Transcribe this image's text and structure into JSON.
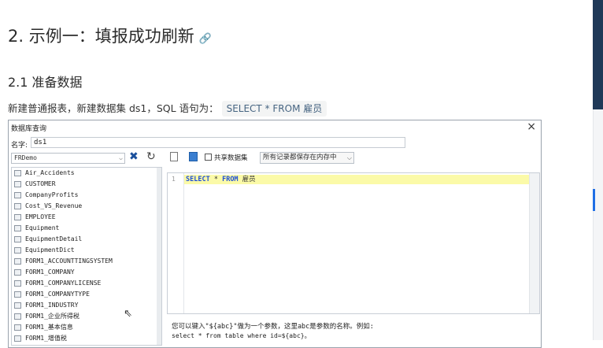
{
  "doc": {
    "heading2": "2. 示例一：填报成功刷新",
    "anchor_icon": "link-icon",
    "heading3": "2.1 准备数据",
    "paragraph_text": "新建普通报表，新建数据集 ds1，SQL 语句为：",
    "paragraph_code": "SELECT * FROM 雇员"
  },
  "dialog": {
    "title": "数据库查询",
    "close": "×",
    "name_label": "名字:",
    "name_value": "ds1",
    "db_select": "FRDemo",
    "share_label": "共享数据集",
    "memory_option": "所有记录都保存在内存中",
    "tables": [
      "Air_Accidents",
      "CUSTOMER",
      "CompanyProfits",
      "Cost_VS_Revenue",
      "EMPLOYEE",
      "Equipment",
      "EquipmentDetail",
      "EquipmentDict",
      "FORM1_ACCOUNTTINGSYSTEM",
      "FORM1_COMPANY",
      "FORM1_COMPANYLICENSE",
      "FORM1_COMPANYTYPE",
      "FORM1_INDUSTRY",
      "FORM1_企业所得税",
      "FORM1_基本信息",
      "FORM1_增值税"
    ],
    "editor": {
      "line_number": "1",
      "sql_kw1": "SELECT",
      "sql_star": " * ",
      "sql_kw2": "FROM",
      "sql_table": " 雇员"
    },
    "hint_line1": "您可以键入\"${abc}\"做为一个参数，这里abc是参数的名称。例如:",
    "hint_line2": "select * from table where id=${abc}。"
  }
}
